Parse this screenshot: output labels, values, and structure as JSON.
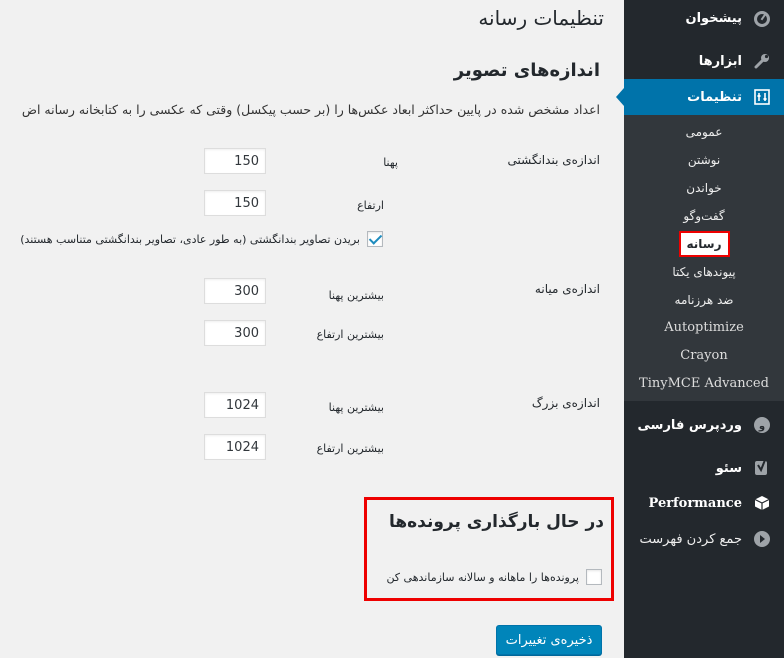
{
  "sidebar": {
    "dashboard": {
      "label": "پیشخوان",
      "icon": "dashboard-icon"
    },
    "tools": {
      "label": "ابزارها",
      "icon": "wrench-icon"
    },
    "settings": {
      "label": "تنظیمات",
      "icon": "settings-icon"
    },
    "submenu": [
      {
        "label": "عمومی"
      },
      {
        "label": "نوشتن"
      },
      {
        "label": "خواندن"
      },
      {
        "label": "گفت‌وگو"
      },
      {
        "label": "رسانه"
      },
      {
        "label": "پیوندهای یکتا"
      },
      {
        "label": "ضد هرزنامه"
      },
      {
        "label": "Autoptimize"
      },
      {
        "label": "Crayon"
      },
      {
        "label": "TinyMCE Advanced"
      }
    ],
    "wp_persian": {
      "label": "وردپرس فارسی",
      "icon": "wp-persian-icon"
    },
    "seo": {
      "label": "سئو",
      "icon": "yoast-icon"
    },
    "performance": {
      "label": "Performance",
      "icon": "performance-cube-icon"
    },
    "collapse": {
      "label": "جمع کردن فهرست",
      "icon": "collapse-arrow-icon"
    }
  },
  "page": {
    "title": "تنظیمات رسانه",
    "image_sizes": {
      "heading": "اندازه‌های تصویر",
      "description": "اعداد مشخص شده در پایین حداکثر ابعاد عکس‌ها را (بر حسب پیکسل) وقتی که عکسی را به کتابخانه رسانه اض",
      "thumbnail": {
        "label": "اندازه‌ی بندانگشتی",
        "width_label": "پهنا",
        "width": "150",
        "height_label": "ارتفاع",
        "height": "150",
        "crop_label": "بریدن تصاویر بندانگشتی (به طور عادی، تصاویر بندانگشتی متناسب هستند)",
        "crop_checked": true
      },
      "medium": {
        "label": "اندازه‌ی میانه",
        "max_width_label": "بیشترین پهنا",
        "max_width": "300",
        "max_height_label": "بیشترین ارتفاع",
        "max_height": "300"
      },
      "large": {
        "label": "اندازه‌ی بزرگ",
        "max_width_label": "بیشترین پهنا",
        "max_width": "1024",
        "max_height_label": "بیشترین ارتفاع",
        "max_height": "1024"
      }
    },
    "uploads": {
      "heading": "در حال بارگذاری پرونده‌ها",
      "organize_label": "پرونده‌ها را ماهانه و سالانه سازماندهی کن",
      "organize_checked": false
    },
    "save_label": "ذخیره‌ی تغییرات"
  },
  "colors": {
    "sidebar_bg": "#23282d",
    "submenu_bg": "#32373c",
    "accent": "#0073aa",
    "button": "#0085ba",
    "highlight_box": "#e00000"
  }
}
